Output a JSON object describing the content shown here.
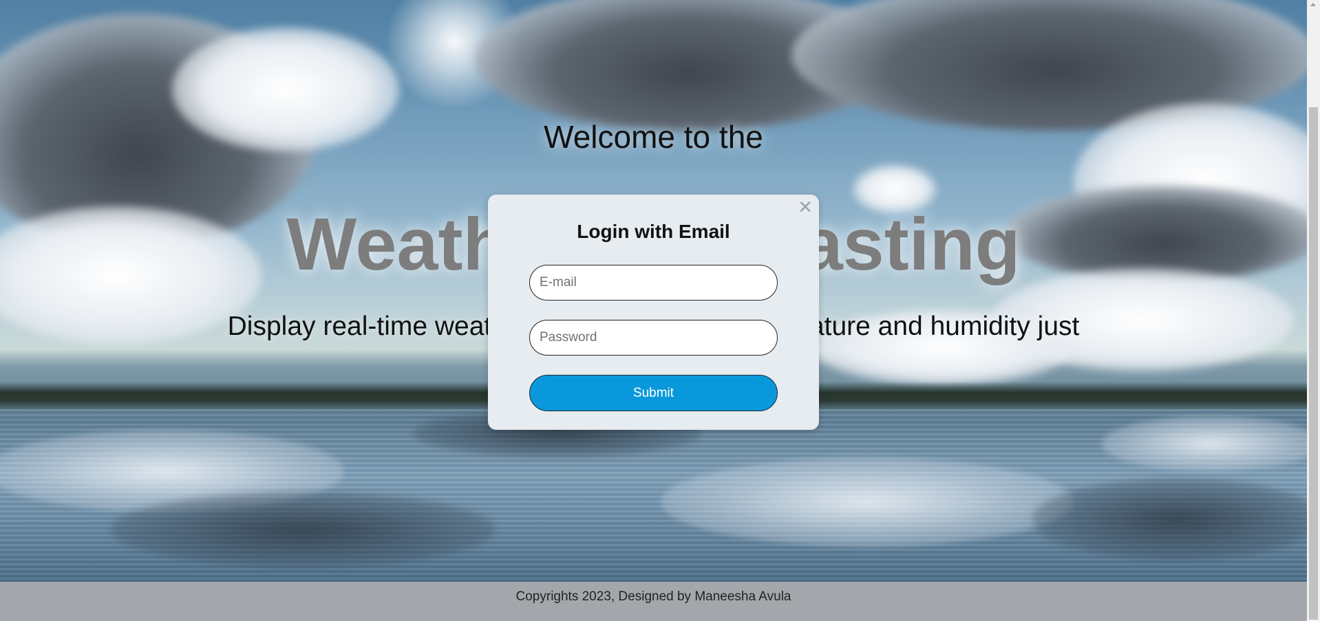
{
  "hero": {
    "welcome": "Welcome to the",
    "title": "Weather Forecasting",
    "subtitle": "Display real-time weather information like temperature and humidity just"
  },
  "modal": {
    "close_icon": "×",
    "title": "Login with Email",
    "email_placeholder": "E-mail",
    "password_placeholder": "Password",
    "submit_label": "Submit"
  },
  "footer": {
    "text": "Copyrights 2023, Designed by Maneesha Avula"
  },
  "colors": {
    "modal_bg": "#e7ecf0",
    "submit_bg": "#0a98dc",
    "footer_bg": "#a3a7ab",
    "title_gray": "#7d7d7d"
  }
}
